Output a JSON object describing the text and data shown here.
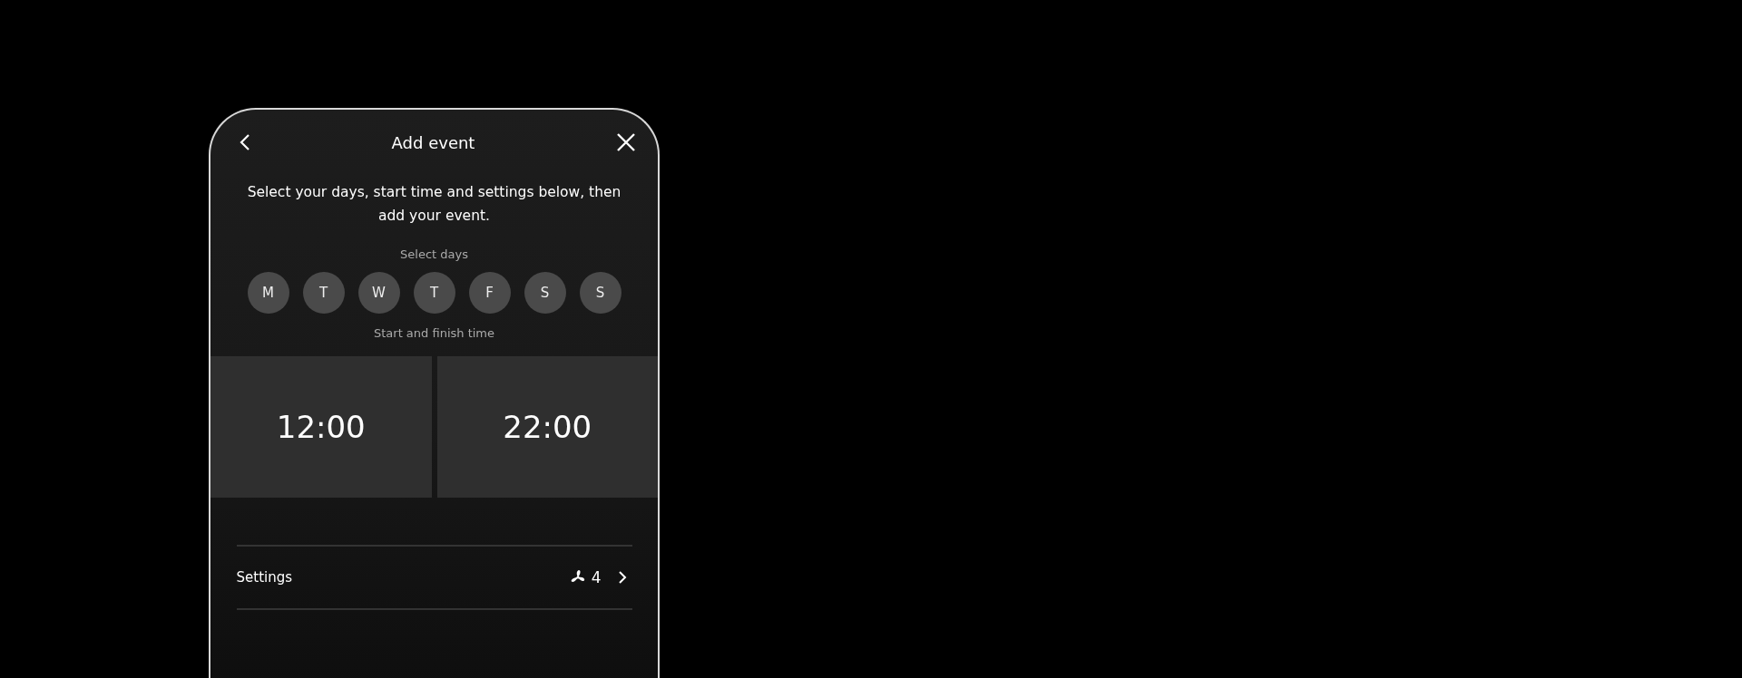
{
  "header": {
    "title": "Add event"
  },
  "intro": "Select your days, start time and settings below, then add your event.",
  "days_label": "Select days",
  "days": [
    {
      "label": "M",
      "selected": false
    },
    {
      "label": "T",
      "selected": false
    },
    {
      "label": "W",
      "selected": false
    },
    {
      "label": "T",
      "selected": false
    },
    {
      "label": "F",
      "selected": false
    },
    {
      "label": "S",
      "selected": false
    },
    {
      "label": "S",
      "selected": false
    }
  ],
  "time_label": "Start and finish time",
  "times": [
    "12:00",
    "22:00"
  ],
  "settings": {
    "label": "Settings",
    "fan_speed": "4"
  }
}
